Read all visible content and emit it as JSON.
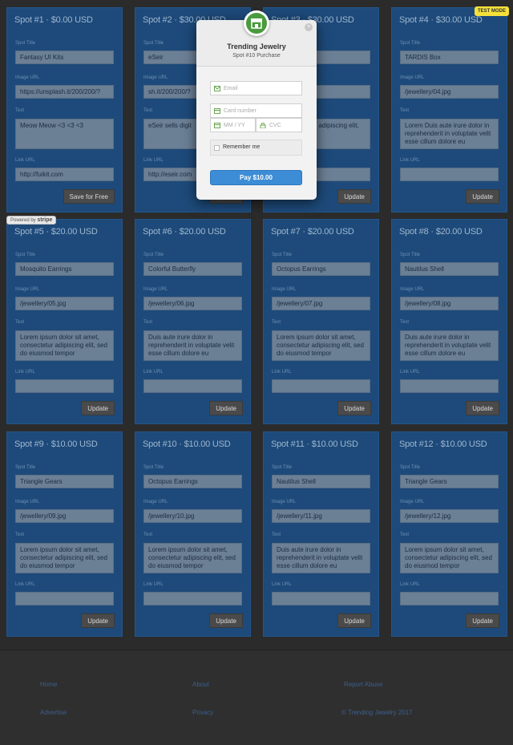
{
  "cards": [
    {
      "title": "Spot #1 · $0.00 USD",
      "spot_title": "Fantasy UI Kits",
      "image_url": "https://unsplash.it/200/200/?",
      "text": "Meow Meow <3 <3 <3",
      "link_url": "http://fuikit.com",
      "button": "Save for Free"
    },
    {
      "title": "Spot #2 · $30.00 USD",
      "spot_title": "eSeir",
      "image_url": "sh.it/200/200/?",
      "text": "eSeir sells digit",
      "link_url": "http://eseir.com",
      "button": "Update"
    },
    {
      "title": "Spot #3 · $30.00 USD",
      "spot_title": "",
      "image_url": "",
      "text": "dolor sit amet, adipiscing elit, od tempor",
      "link_url": "",
      "button": "Update"
    },
    {
      "title": "Spot #4 · $30.00 USD",
      "spot_title": "TARDIS Box",
      "image_url": "/jewellery/04.jpg",
      "text": "Lorem Duis aute irure dolor in reprehenderit in voluptate velit esse cillum dolore eu",
      "link_url": "",
      "button": "Update"
    },
    {
      "title": "Spot #5 · $20.00 USD",
      "spot_title": "Mosquito Earrings",
      "image_url": "/jewellery/05.jpg",
      "text": "Lorem ipsum dolor sit amet, consectetur adipiscing elit, sed do eiusmod tempor",
      "link_url": "",
      "button": "Update"
    },
    {
      "title": "Spot #6 · $20.00 USD",
      "spot_title": "Colorful Butterfly",
      "image_url": "/jewellery/06.jpg",
      "text": "Duis aute irure dolor in reprehenderit in voluptate velit esse cillum dolore eu",
      "link_url": "",
      "button": "Update"
    },
    {
      "title": "Spot #7 · $20.00 USD",
      "spot_title": "Octopus Earrings",
      "image_url": "/jewellery/07.jpg",
      "text": "Lorem ipsum dolor sit amet, consectetur adipiscing elit, sed do eiusmod tempor",
      "link_url": "",
      "button": "Update"
    },
    {
      "title": "Spot #8 · $20.00 USD",
      "spot_title": "Nautilus Shell",
      "image_url": "/jewellery/08.jpg",
      "text": "Duis aute irure dolor in reprehenderit in voluptate velit esse cillum dolore eu",
      "link_url": "",
      "button": "Update"
    },
    {
      "title": "Spot #9 · $10.00 USD",
      "spot_title": "Triangle Gears",
      "image_url": "/jewellery/09.jpg",
      "text": "Lorem ipsum dolor sit amet, consectetur adipiscing elit, sed do eiusmod tempor",
      "link_url": "",
      "button": "Update"
    },
    {
      "title": "Spot #10 · $10.00 USD",
      "spot_title": "Octopus Earrings",
      "image_url": "/jewellery/10.jpg",
      "text": "Lorem ipsum dolor sit amet, consectetur adipiscing elit, sed do eiusmod tempor",
      "link_url": "",
      "button": "Update"
    },
    {
      "title": "Spot #11 · $10.00 USD",
      "spot_title": "Nautilus Shell",
      "image_url": "/jewellery/11.jpg",
      "text": "Duis aute irure dolor in reprehenderit in voluptate velit esse cillum dolore eu",
      "link_url": "",
      "button": "Update"
    },
    {
      "title": "Spot #12 · $10.00 USD",
      "spot_title": "Triangle Gears",
      "image_url": "/jewellery/12.jpg",
      "text": "Lorem ipsum dolor sit amet, consectetur adipiscing elit, sed do eiusmod tempor",
      "link_url": "",
      "button": "Update"
    }
  ],
  "labels": {
    "spot_title": "Spot Title",
    "image_url": "Image URL",
    "text": "Text",
    "link_url": "Link URL"
  },
  "badges": {
    "powered_by": "Powered by",
    "stripe": "stripe",
    "test_mode": "TEST MODE"
  },
  "modal": {
    "title": "Trending Jewelry",
    "subtitle": "Spot #10 Purchase",
    "email_placeholder": "Email",
    "card_placeholder": "Card number",
    "expiry_placeholder": "MM / YY",
    "cvc_placeholder": "CVC",
    "remember_label": "Remember me",
    "pay_label": "Pay $10.00",
    "close_glyph": "×"
  },
  "footer": {
    "home": "Home",
    "about": "About",
    "report": "Report Abuse",
    "advertise": "Advertise",
    "privacy": "Privacy",
    "copyright": "© Trending Jewelry 2017"
  },
  "colors": {
    "card_bg": "#1d4a7a",
    "pay_button": "#3c8dd6",
    "logo_green": "#4a9a3e",
    "test_mode": "#f5e13a"
  }
}
